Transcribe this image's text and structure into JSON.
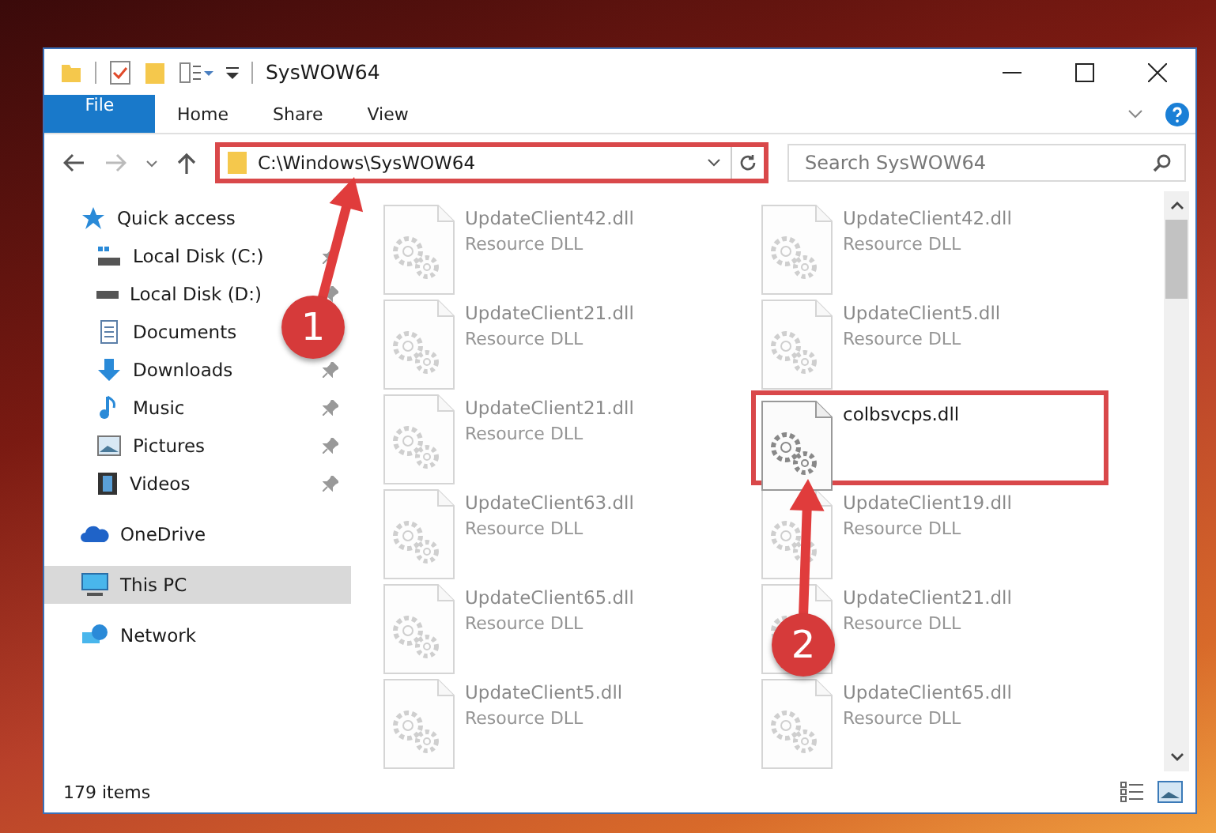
{
  "window": {
    "title": "SysWOW64"
  },
  "ribbon": {
    "tabs": [
      {
        "label": "File",
        "kind": "file",
        "selected": false
      },
      {
        "label": "Home",
        "kind": "tab",
        "selected": false
      },
      {
        "label": "Share",
        "kind": "tab",
        "selected": false
      },
      {
        "label": "View",
        "kind": "tab",
        "selected": false
      }
    ]
  },
  "address_bar": {
    "path": "C:\\Windows\\SysWOW64",
    "highlighted": true
  },
  "search": {
    "placeholder": "Search SysWOW64"
  },
  "sidebar": {
    "items": [
      {
        "label": "Quick access",
        "kind": "star",
        "selected": false,
        "children": [
          {
            "label": "Local Disk (C:)",
            "kind": "drive-c",
            "pinned": true,
            "selected": false
          },
          {
            "label": "Local Disk (D:)",
            "kind": "drive",
            "pinned": true,
            "selected": false
          },
          {
            "label": "Documents",
            "kind": "document",
            "selected": false
          },
          {
            "label": "Downloads",
            "kind": "download",
            "pinned": true,
            "selected": false
          },
          {
            "label": "Music",
            "kind": "music",
            "pinned": true,
            "selected": false
          },
          {
            "label": "Pictures",
            "kind": "picture",
            "pinned": true,
            "selected": false
          },
          {
            "label": "Videos",
            "kind": "video",
            "pinned": true,
            "selected": false
          }
        ]
      },
      {
        "label": "OneDrive",
        "kind": "cloud",
        "selected": false
      },
      {
        "label": "This PC",
        "kind": "pc",
        "selected": true
      },
      {
        "label": "Network",
        "kind": "network",
        "selected": false
      }
    ]
  },
  "files": [
    {
      "name": "UpdateClient42.dll",
      "type": "Resource DLL",
      "highlighted": false
    },
    {
      "name": "UpdateClient42.dll",
      "type": "Resource DLL",
      "highlighted": false
    },
    {
      "name": "UpdateClient21.dll",
      "type": "Resource DLL",
      "highlighted": false
    },
    {
      "name": "UpdateClient5.dll",
      "type": "Resource DLL",
      "highlighted": false
    },
    {
      "name": "UpdateClient21.dll",
      "type": "Resource DLL",
      "highlighted": false
    },
    {
      "name": "colbsvcps.dll",
      "highlighted": true
    },
    {
      "name": "UpdateClient63.dll",
      "type": "Resource DLL",
      "highlighted": false
    },
    {
      "name": "UpdateClient19.dll",
      "type": "Resource DLL",
      "highlighted": false
    },
    {
      "name": "UpdateClient65.dll",
      "type": "Resource DLL",
      "highlighted": false
    },
    {
      "name": "UpdateClient21.dll",
      "type": "Resource DLL",
      "highlighted": false
    },
    {
      "name": "UpdateClient5.dll",
      "type": "Resource DLL",
      "highlighted": false
    },
    {
      "name": "UpdateClient65.dll",
      "type": "Resource DLL",
      "highlighted": false
    }
  ],
  "status_bar": {
    "count": "179 items"
  },
  "annotations": [
    {
      "number": "1"
    },
    {
      "number": "2"
    }
  ]
}
